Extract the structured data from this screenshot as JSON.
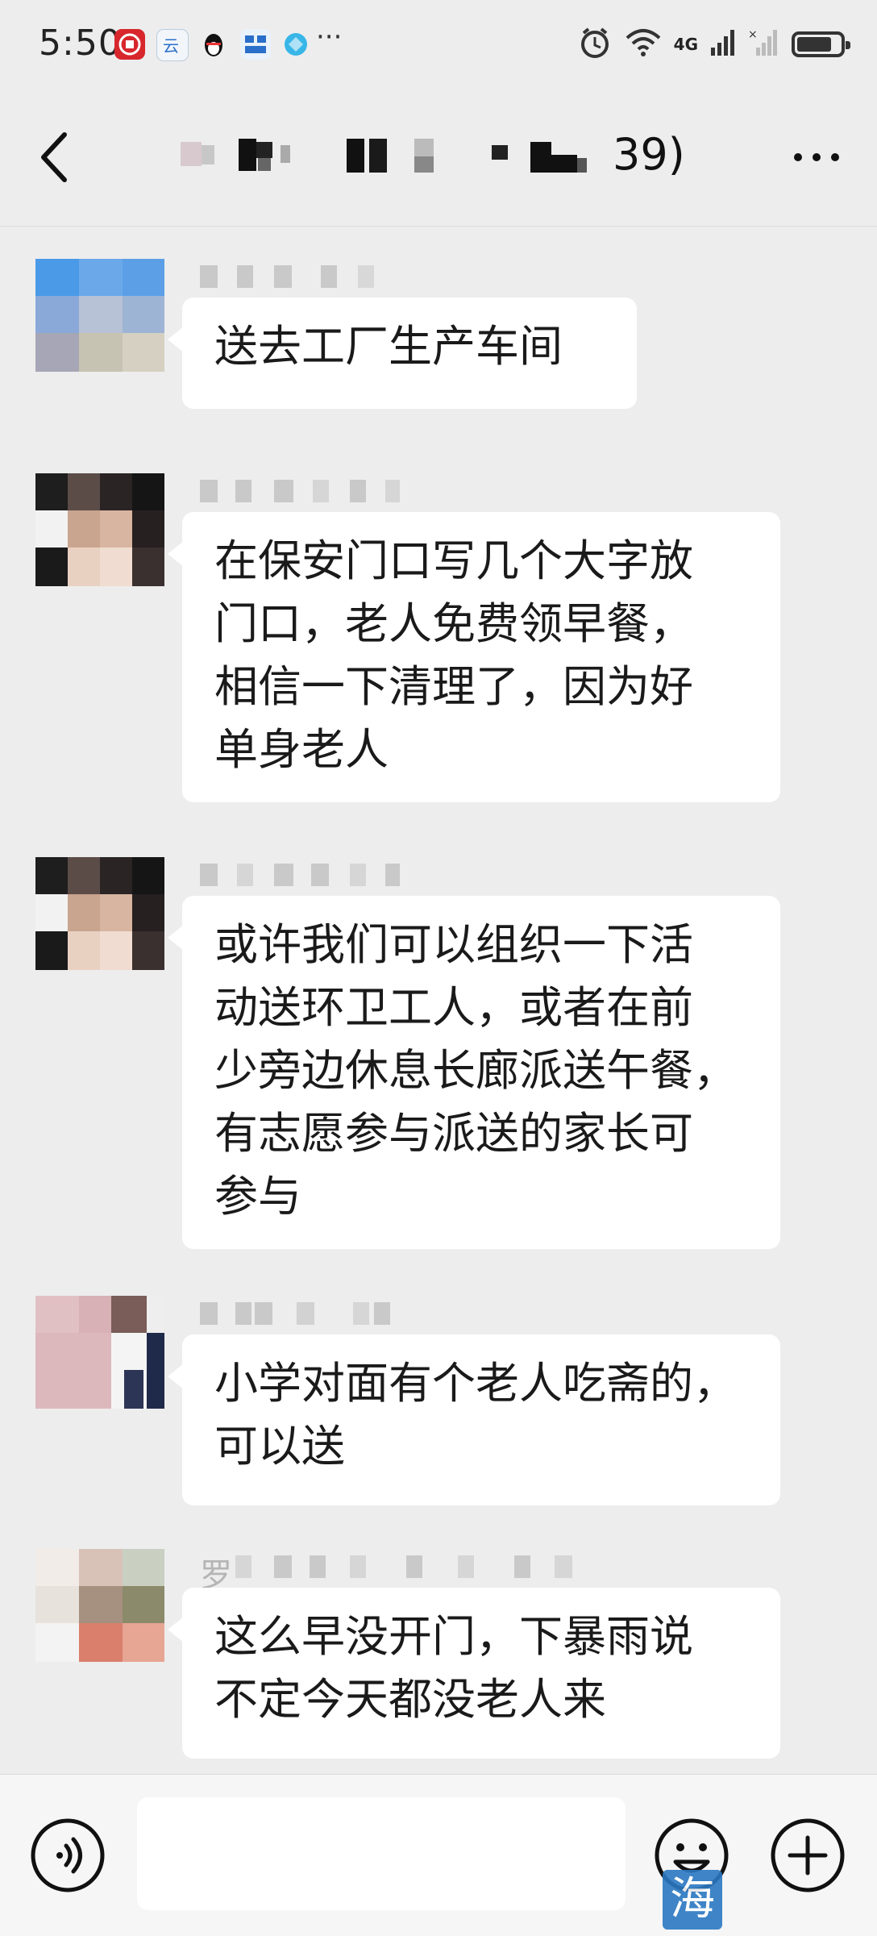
{
  "status_bar": {
    "time": "5:50",
    "notification_icons": [
      "bank-app-icon",
      "cloud-app-icon",
      "qq-penguin-icon",
      "grid-app-icon",
      "browser-app-icon"
    ],
    "more_notifications": "···",
    "network_label": "4G",
    "battery_level": 0.8
  },
  "nav": {
    "title_suffix": "39)",
    "title_redacted": true
  },
  "messages": [
    {
      "sender_visible": "",
      "text": "送去工厂生产车间"
    },
    {
      "sender_visible": "",
      "text": "在保安门口写几个大字放\n门口，老人免费领早餐，\n相信一下清理了，因为好\n单身老人"
    },
    {
      "sender_visible": "",
      "text": "或许我们可以组织一下活\n动送环卫工人，或者在前\n少旁边休息长廊派送午餐，\n有志愿参与派送的家长可\n参与"
    },
    {
      "sender_visible": "",
      "text": "小学对面有个老人吃斋的，\n可以送"
    },
    {
      "sender_visible": "罗",
      "text": "这么早没开门，下暴雨说\n不定今天都没老人来"
    }
  ],
  "input": {
    "value": ""
  },
  "watermark": {
    "logo_char": "海"
  },
  "colors": {
    "background": "#ededed",
    "bubble": "#ffffff",
    "watermark_blue": "#2b78c2"
  }
}
